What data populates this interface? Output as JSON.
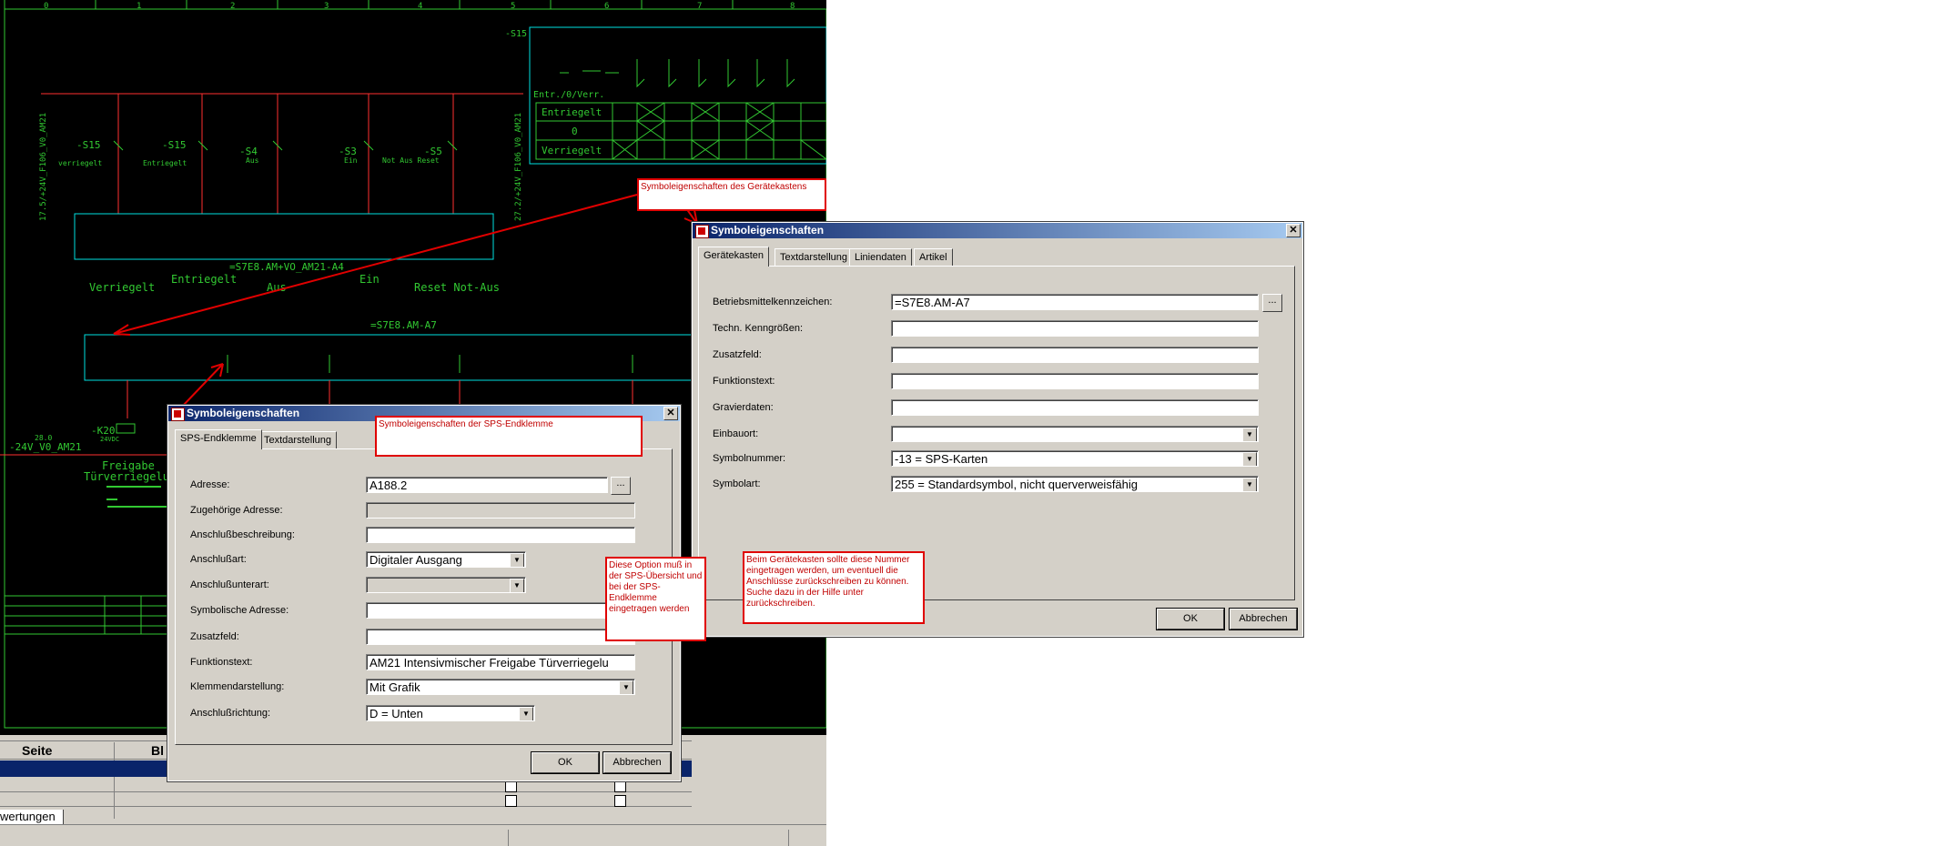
{
  "cad": {
    "ruler": [
      "0",
      "1",
      "2",
      "3",
      "4",
      "5",
      "6",
      "7",
      "8"
    ],
    "labels": {
      "s15_top": "-S15",
      "entr": "Entr./0/Verr.",
      "row1": "Entriegelt",
      "row2": "0",
      "row3": "Verriegelt",
      "left_rail": "17.5/+24V_F106_V0_AM21",
      "right_rail": "27.2/+24V_F106_V0_AM21",
      "sw1": "-S15",
      "sw1_sub": "verriegelt",
      "sw2": "-S15",
      "sw2_sub": "Entriegelt",
      "sw3": "-S4",
      "sw3_sub": "Aus",
      "sw4": "-S3",
      "sw4_sub": "Ein",
      "sw5": "-S5",
      "sw5_sub": "Not Aus Reset",
      "module1": "=S7E8.AM+VO_AM21-A4",
      "t_verr": "Verriegelt",
      "t_entr": "Entriegelt",
      "t_aus": "Aus",
      "t_ein": "Ein",
      "t_reset": "Reset Not-Aus",
      "module2": "=S7E8.AM-A7",
      "relay": "-K20",
      "relay_v": "24VDC",
      "rail2_num": "28.0",
      "rail2": "-24V_V0_AM21",
      "freigabe": "Freigabe",
      "tuer": "Türverriegelun"
    }
  },
  "bottom": {
    "col_seite": "Seite",
    "col_bl": "Bl",
    "tab": "wertungen"
  },
  "annotations": {
    "gk_title": "Symboleigenschaften des Gerätekastens",
    "sps_title": "Symboleigenschaften der SPS-Endklemme",
    "option_note": "Diese Option muß in der SPS-Übersicht und bei der SPS-Endklemme eingetragen werden",
    "gk_note": "Beim Gerätekasten sollte diese Nummer eingetragen werden, um eventuell die Anschlüsse zurückschreiben zu können. Suche dazu in der Hilfe unter zurückschreiben."
  },
  "dialog_gk": {
    "title": "Symboleigenschaften",
    "tabs": [
      "Gerätekasten",
      "Textdarstellung",
      "Liniendaten",
      "Artikel"
    ],
    "fields": [
      {
        "label": "Betriebsmittelkennzeichen:",
        "value": "=S7E8.AM-A7"
      },
      {
        "label": "Techn. Kenngrößen:",
        "value": ""
      },
      {
        "label": "Zusatzfeld:",
        "value": ""
      },
      {
        "label": "Funktionstext:",
        "value": ""
      },
      {
        "label": "Gravierdaten:",
        "value": ""
      },
      {
        "label": "Einbauort:",
        "value": ""
      },
      {
        "label": "Symbolnummer:",
        "value": "-13 = SPS-Karten"
      },
      {
        "label": "Symbolart:",
        "value": "255 = Standardsymbol, nicht querverweisfähig"
      }
    ],
    "browse": "...",
    "ok": "OK",
    "cancel": "Abbrechen"
  },
  "dialog_sps": {
    "title": "Symboleigenschaften",
    "tabs": [
      "SPS-Endklemme",
      "Textdarstellung"
    ],
    "fields": [
      {
        "label": "Adresse:",
        "value": "A188.2"
      },
      {
        "label": "Zugehörige Adresse:",
        "value": ""
      },
      {
        "label": "Anschlußbeschreibung:",
        "value": ""
      },
      {
        "label": "Anschlußart:",
        "value": "Digitaler Ausgang"
      },
      {
        "label": "Anschlußunterart:",
        "value": ""
      },
      {
        "label": "Symbolische Adresse:",
        "value": ""
      },
      {
        "label": "Zusatzfeld:",
        "value": ""
      },
      {
        "label": "Funktionstext:",
        "value": "AM21 Intensivmischer Freigabe Türverriegelu"
      },
      {
        "label": "Klemmendarstellung:",
        "value": "Mit Grafik"
      },
      {
        "label": "Anschlußrichtung:",
        "value": "D = Unten"
      }
    ],
    "browse": "...",
    "ok": "OK",
    "cancel": "Abbrechen"
  },
  "colors": {
    "arrow": "#e00000",
    "wire": "#ff3030",
    "cyan": "#00e0e0",
    "green": "#32c832"
  }
}
